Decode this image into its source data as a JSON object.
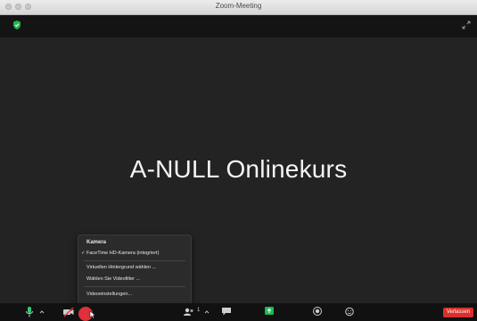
{
  "window": {
    "title": "Zoom-Meeting"
  },
  "meeting": {
    "banner_text": "A-NULL Onlinekurs"
  },
  "camera_menu": {
    "heading": "Kamera",
    "items": [
      {
        "label": "FaceTime HD-Kamera (integriert)",
        "checked": true
      },
      {
        "label": "Virtuellen Hintergrund wählen ..."
      },
      {
        "label": "Wählen Sie Videofilter ..."
      },
      {
        "label": "Videoeinstellungen..."
      }
    ]
  },
  "toolbar": {
    "participants_count": "1",
    "leave_label": "Verlassen"
  },
  "colors": {
    "leave": "#d9302c",
    "share": "#1db954",
    "accent": "#2ecc71"
  },
  "icons": [
    "shield-icon",
    "fullscreen-icon",
    "microphone-icon",
    "video-off-icon",
    "participants-icon",
    "chat-icon",
    "share-screen-icon",
    "record-icon",
    "reactions-icon",
    "cursor-icon"
  ]
}
